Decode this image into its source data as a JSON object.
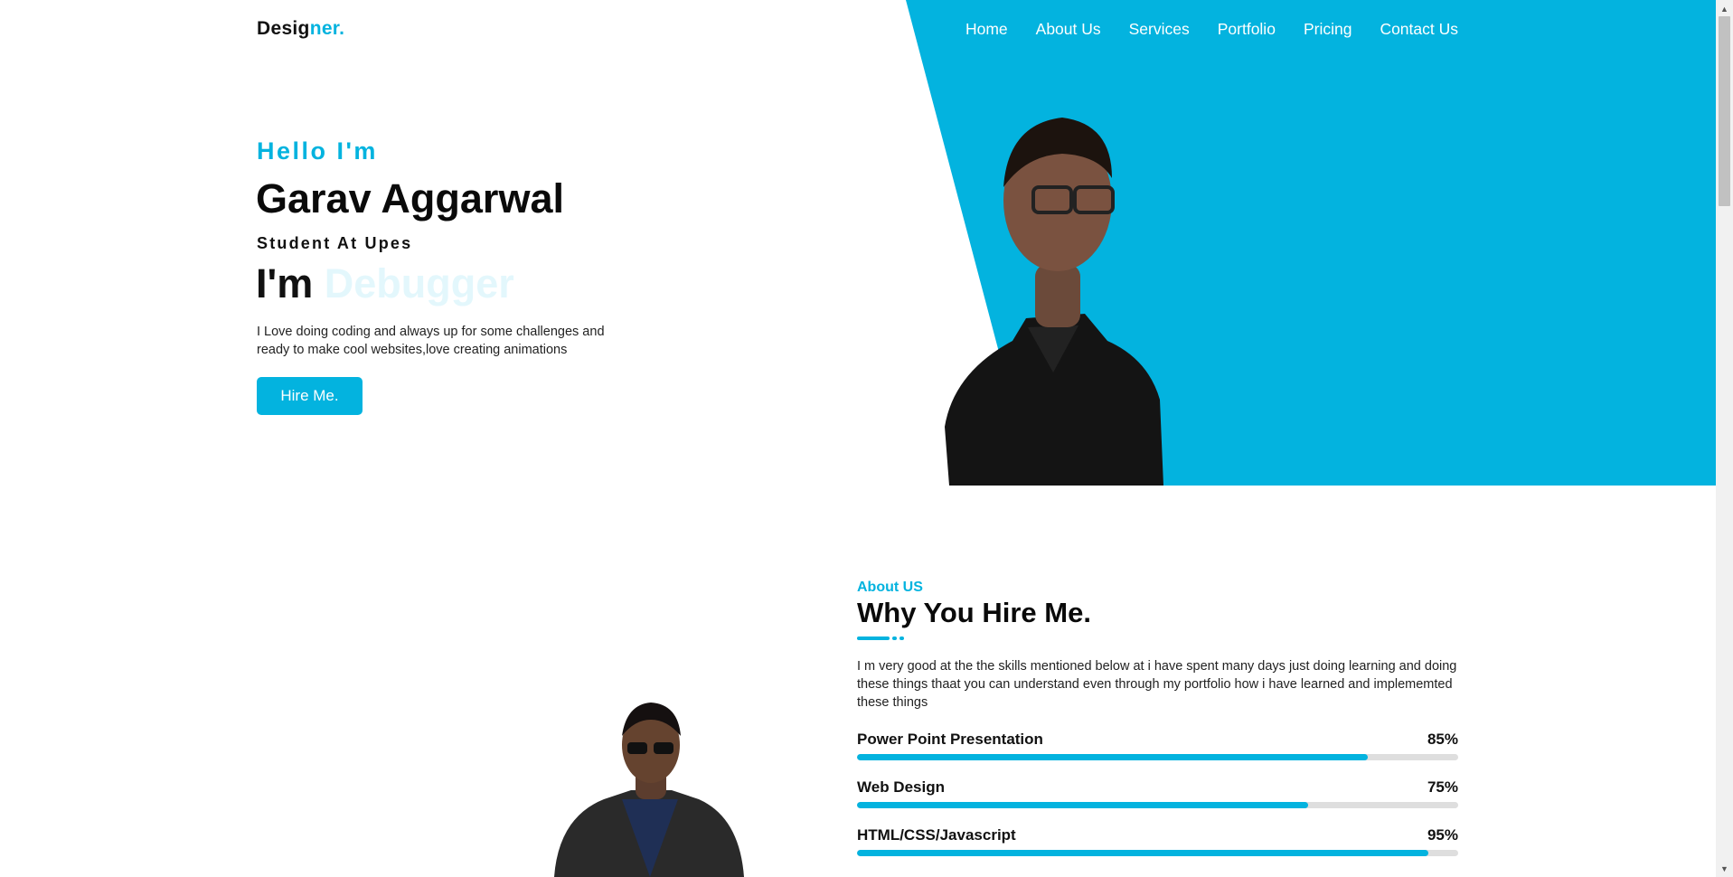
{
  "brand": {
    "logo_main": "Desig",
    "logo_accent": "ner."
  },
  "nav": {
    "items": [
      "Home",
      "About Us",
      "Services",
      "Portfolio",
      "Pricing",
      "Contact Us"
    ]
  },
  "hero": {
    "greeting": "Hello I'm",
    "name": "Garav Aggarwal",
    "role": "Student At Upes",
    "typed_prefix": "I'm",
    "typed_word": "Debugger",
    "intro": "I Love doing coding and always up for some challenges and ready to make cool websites,love creating animations",
    "hire_label": "Hire Me."
  },
  "about": {
    "tag": "About US",
    "title": "Why You Hire Me.",
    "text": "I m very good at the the skills mentioned below at i have spent many days just doing learning and doing these things thaat you can understand even through my portfolio how i have learned and implememted these things"
  },
  "skills": [
    {
      "name": "Power Point Presentation",
      "percent_label": "85%",
      "value": 85
    },
    {
      "name": "Web Design",
      "percent_label": "75%",
      "value": 75
    },
    {
      "name": "HTML/CSS/Javascript",
      "percent_label": "95%",
      "value": 95
    }
  ],
  "colors": {
    "accent": "#03b3df",
    "typed_word": "#e3f7fc",
    "track": "#dedede"
  }
}
